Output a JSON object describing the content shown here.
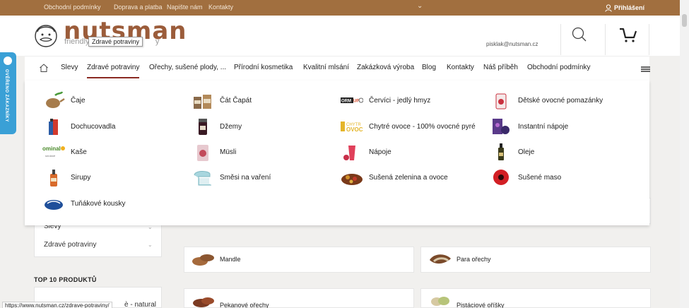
{
  "topbar": {
    "links": [
      "Obchodní podmínky",
      "Doprava a platba",
      "Napište nám",
      "Kontakty"
    ],
    "login_label": "Přihlášení"
  },
  "header": {
    "logo_text": "nutsman",
    "logo_sub_left": "friendly &",
    "logo_sub_right": "y",
    "tooltip": "Zdravé potraviny",
    "email": "pisklak@nutsman.cz"
  },
  "nav": {
    "items": [
      "Slevy",
      "Zdravé potraviny",
      "Ořechy, sušené plody, ...",
      "Přírodní kosmetika",
      "Kvalitní mlsání",
      "Zakázková výroba",
      "Blog",
      "Kontakty",
      "Náš příběh",
      "Obchodní podmínky"
    ],
    "active_index": 1
  },
  "badge": {
    "text": "OVĚŘENO ZÁKAZNÍKY"
  },
  "dropdown": {
    "categories": [
      {
        "label": "Čaje",
        "icon": "teapot-icon"
      },
      {
        "label": "Čát Čapát",
        "icon": "jars-icon"
      },
      {
        "label": "Červíci - jedlý hmyz",
        "icon": "wormup-logo-icon"
      },
      {
        "label": "Dětské ovocné pomazánky",
        "icon": "fruit-jar-icon"
      },
      {
        "label": "Dochucovadla",
        "icon": "spice-bottles-icon"
      },
      {
        "label": "Džemy",
        "icon": "jam-jar-icon"
      },
      {
        "label": "Chytré ovoce - 100% ovocné pyré",
        "icon": "chytre-ovoce-logo-icon"
      },
      {
        "label": "Instantní nápoje",
        "icon": "instant-drink-pack-icon"
      },
      {
        "label": "Kaše",
        "icon": "ominal-logo-icon"
      },
      {
        "label": "Müsli",
        "icon": "musli-bag-icon"
      },
      {
        "label": "Nápoje",
        "icon": "drink-glass-icon"
      },
      {
        "label": "Oleje",
        "icon": "oil-bottle-icon"
      },
      {
        "label": "Sirupy",
        "icon": "syrup-bottle-icon"
      },
      {
        "label": "Směsi na vaření",
        "icon": "kitchen-mixer-icon"
      },
      {
        "label": "Sušená zelenina a ovoce",
        "icon": "dried-fruit-icon"
      },
      {
        "label": "Sušené maso",
        "icon": "dried-meat-logo-icon"
      },
      {
        "label": "Tuňákové kousky",
        "icon": "tuna-logo-icon"
      }
    ]
  },
  "sidebar": {
    "items": [
      "Slevy",
      "Zdravé potraviny"
    ],
    "top10_title": "TOP 10 PRODUKTŮ",
    "top10_partial": "è - natural"
  },
  "products": [
    "Mandle",
    "Para ořechy",
    "Pekanové ořechy",
    "Pistáciové oříšky"
  ],
  "status_url": "https://www.nutsman.cz/zdrave-potraviny/",
  "colors": {
    "topbar": "#a16f3f",
    "logo": "#9b5c3a",
    "badge": "#3aa0d6",
    "active_underline": "#8a2a22"
  }
}
